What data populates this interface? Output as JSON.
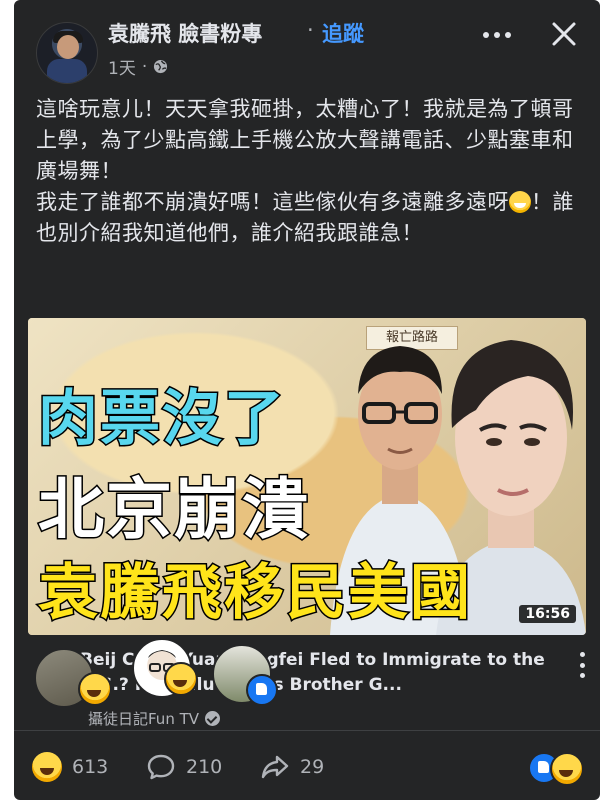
{
  "post": {
    "author": "袁騰飛 臉書粉專",
    "dot": "·",
    "follow_label": "追蹤",
    "timestamp": "1天",
    "meta_dot": "·",
    "text_line1": "這啥玩意儿！天天拿我砸掛，太糟心了！我就是為了頓哥上學，為了少點高鐵上手機公放大聲講電話、少點塞車和廣場舞！",
    "text_line2a": "我走了誰都不崩潰好嗎！這些傢伙有多遠離多遠呀",
    "text_line2b": "！誰也別介紹我知道他們，誰介紹我跟誰急！"
  },
  "thumbnail": {
    "headline1": "肉票沒了",
    "headline2": "北京崩潰",
    "headline3": "袁騰飛移民美國",
    "duration": "16:56",
    "map_label": "報亡路路"
  },
  "video": {
    "title": "Beij   Cris     s Yuan Tengfei Fled to Immigrate to the U.S.? P    P Influencer's Brother G...",
    "channel": "攝徒日記Fun TV"
  },
  "actions": {
    "reactions_count": "613",
    "comments_count": "210",
    "shares_count": "29"
  },
  "colors": {
    "background": "#242526",
    "text": "#e4e6eb",
    "muted": "#b0b3b8",
    "link": "#4599ff",
    "headline_cyan": "#58d7ee",
    "headline_yellow": "#ffe41a"
  },
  "icons": [
    "globe-icon",
    "more-icon",
    "close-icon",
    "laughing-emoji-icon",
    "verified-icon",
    "kebab-icon",
    "haha-icon",
    "like-icon",
    "comment-icon",
    "share-icon"
  ]
}
